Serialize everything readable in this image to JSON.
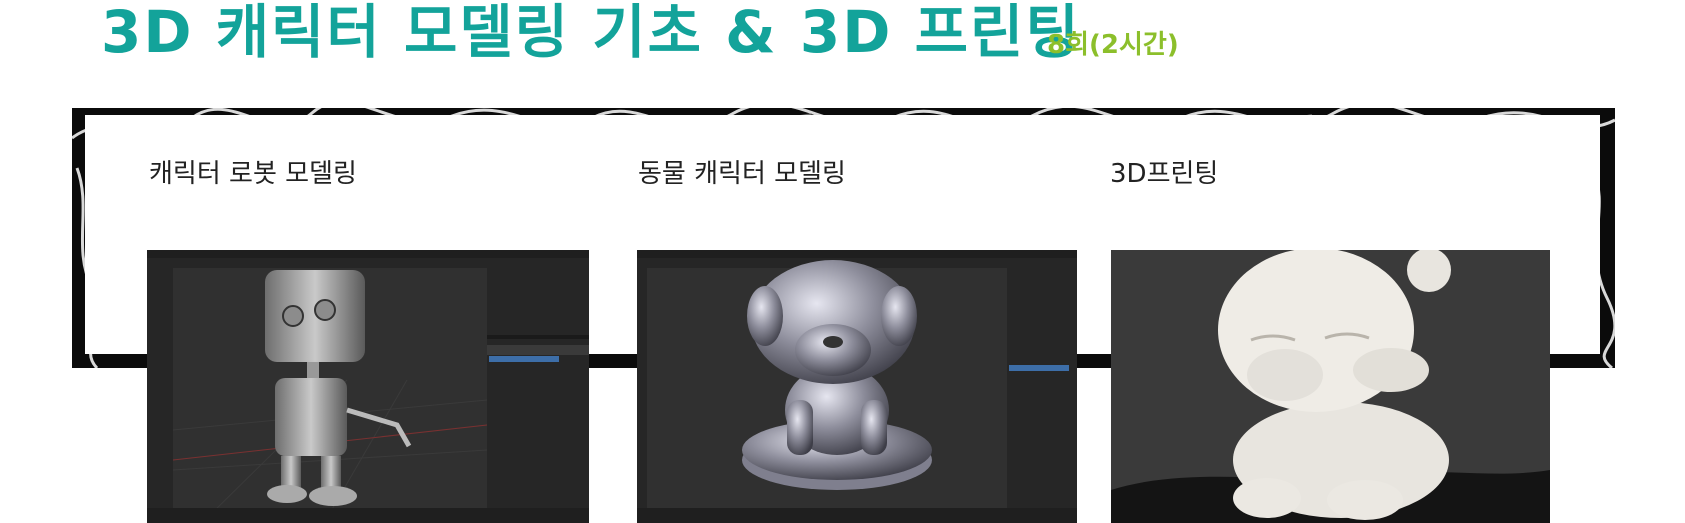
{
  "header": {
    "title": "3D 캐릭터 모델링 기초 & 3D 프린팅",
    "session": "8회(2시간)"
  },
  "items": [
    {
      "label": "캐릭터 로봇 모델링",
      "image": "blender-robot-model-screenshot"
    },
    {
      "label": "동물 캐릭터 모델링",
      "image": "blender-dog-model-screenshot"
    },
    {
      "label": "3D프린팅",
      "image": "printed-bear-figure-photo"
    }
  ],
  "colors": {
    "title": "#13a39a",
    "session": "#8cbf2b",
    "band": "#0b0b0b"
  }
}
